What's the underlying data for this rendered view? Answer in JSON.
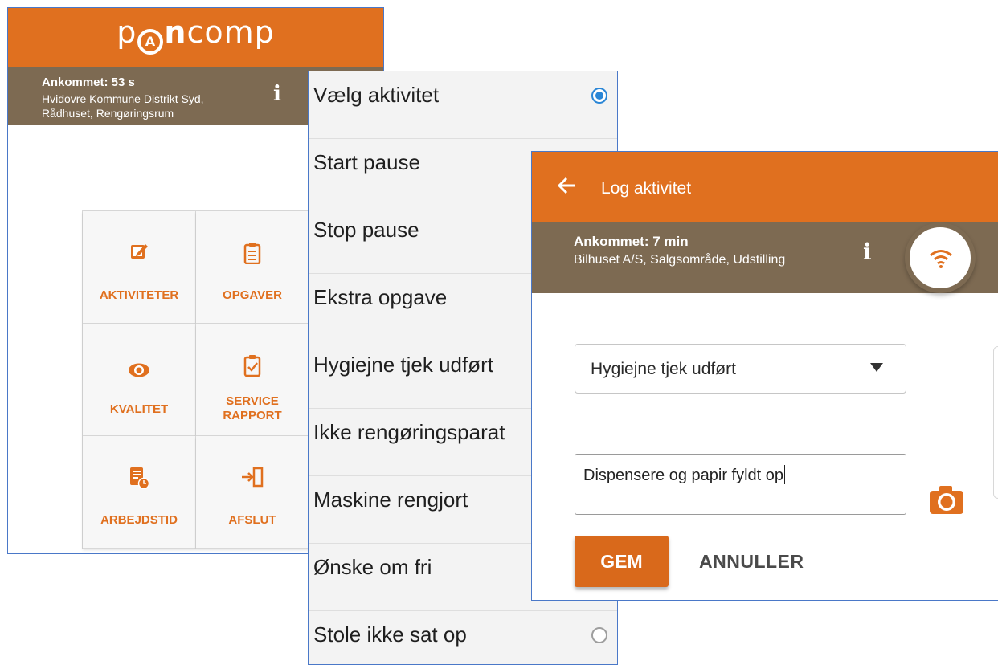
{
  "colors": {
    "brand_orange": "#e0701f",
    "status_brown": "#7d6a52",
    "radio_blue": "#2a86d6"
  },
  "home": {
    "logo": {
      "pre": "p",
      "mark": "A",
      "bold": "n",
      "post": "comp"
    },
    "status": {
      "arrival": "Ankommet: 53 s",
      "location_line1": "Hvidovre Kommune Distrikt Syd,",
      "location_line2": "Rådhuset, Rengøringsrum",
      "info_icon": "info-icon"
    },
    "tiles": [
      {
        "label": "AKTIVITETER",
        "icon": "edit-icon"
      },
      {
        "label": "OPGAVER",
        "icon": "clipboard-icon"
      },
      {
        "label": "KVALITET",
        "icon": "eye-icon"
      },
      {
        "label_line1": "SERVICE",
        "label_line2": "RAPPORT",
        "icon": "clipboard-check-icon"
      },
      {
        "label": "ARBEJDSTID",
        "icon": "timesheet-icon"
      },
      {
        "label": "AFSLUT",
        "icon": "exit-icon"
      }
    ]
  },
  "activity_list": {
    "items": [
      {
        "label": "Vælg aktivitet",
        "selected": true
      },
      {
        "label": "Start pause",
        "selected": false
      },
      {
        "label": "Stop pause",
        "selected": false
      },
      {
        "label": "Ekstra opgave",
        "selected": false
      },
      {
        "label": "Hygiejne tjek udført",
        "selected": false
      },
      {
        "label": "Ikke rengøringsparat",
        "selected": false
      },
      {
        "label": "Maskine rengjort",
        "selected": false
      },
      {
        "label": "Ønske om fri",
        "selected": false
      },
      {
        "label": "Stole ikke sat op",
        "selected": false
      }
    ]
  },
  "log_activity": {
    "title": "Log aktivitet",
    "status": {
      "arrival": "Ankommet: 7 min",
      "location": "Bilhuset A/S, Salgsområde, Udstilling",
      "info_icon": "info-icon",
      "connection_icon": "wifi-icon"
    },
    "selected_activity": "Hygiejne tjek udført",
    "comment": "Dispensere og papir fyldt op",
    "save_label": "GEM",
    "cancel_label": "ANNULLER"
  }
}
